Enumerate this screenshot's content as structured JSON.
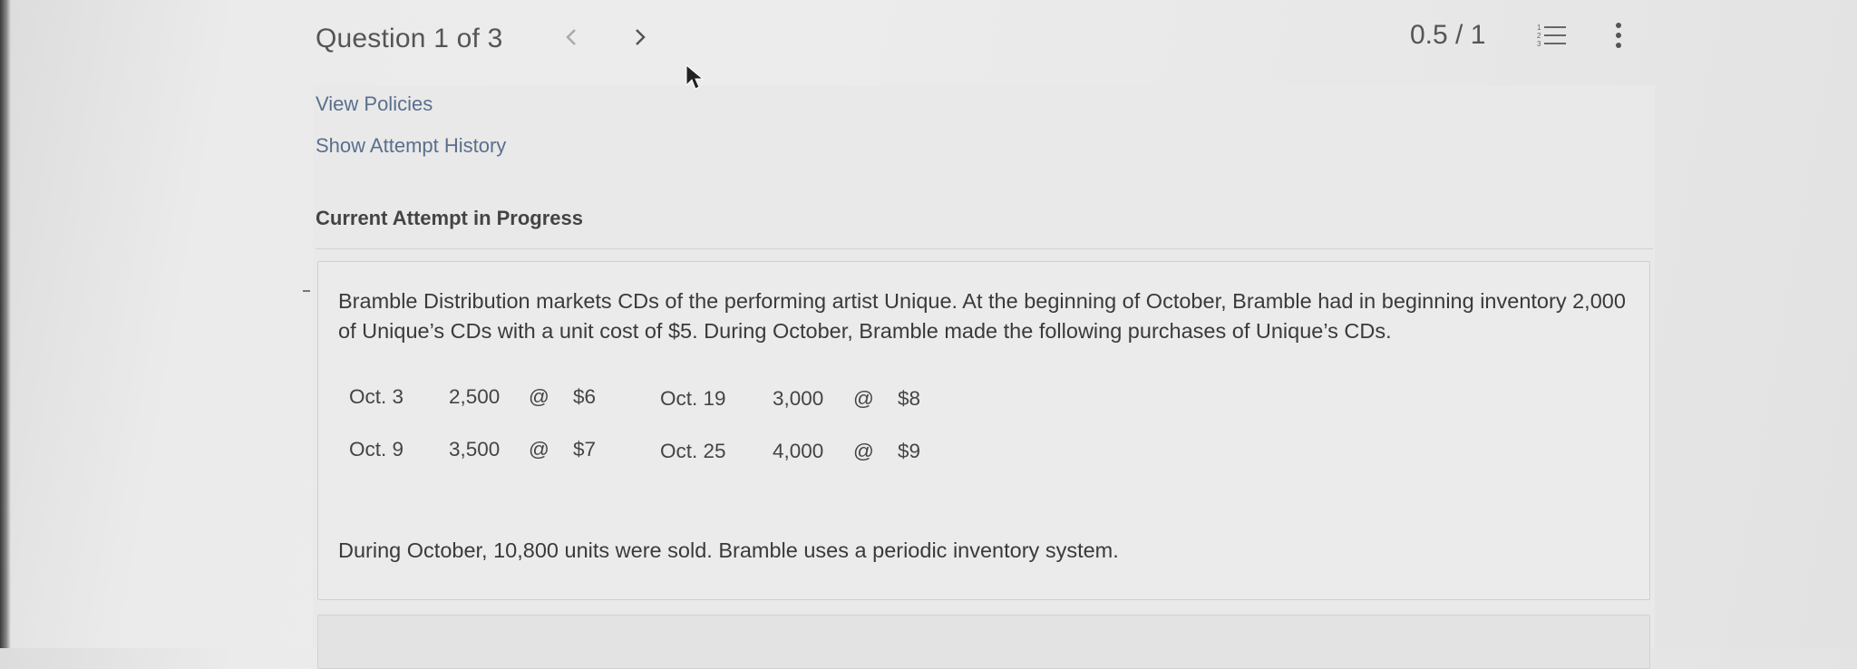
{
  "header": {
    "question_label": "Question 1 of 3",
    "prev_icon": "chevron-left-icon",
    "next_icon": "chevron-right-icon",
    "score": "0.5 / 1",
    "list_icon": "numbered-list-icon",
    "more_icon": "more-vertical-icon"
  },
  "links": {
    "view_policies": "View Policies",
    "show_attempt_history": "Show Attempt History"
  },
  "attempt": {
    "heading": "Current Attempt in Progress"
  },
  "question": {
    "intro": "Bramble Distribution markets CDs of the performing artist Unique. At the beginning of October, Bramble had in beginning inventory 2,000 of Unique’s CDs with a unit cost of $5. During October, Bramble made the following purchases of Unique’s CDs.",
    "purchases": [
      {
        "date": "Oct. 3",
        "units": "2,500",
        "at": "@",
        "cost": "$6"
      },
      {
        "date": "Oct. 9",
        "units": "3,500",
        "at": "@",
        "cost": "$7"
      },
      {
        "date": "Oct. 19",
        "units": "3,000",
        "at": "@",
        "cost": "$8"
      },
      {
        "date": "Oct. 25",
        "units": "4,000",
        "at": "@",
        "cost": "$9"
      }
    ],
    "sold_text": "During October, 10,800 units were sold. Bramble uses a periodic inventory system."
  },
  "colors": {
    "link": "#5a6f8e",
    "text": "#3a3a3a",
    "background": "#e9e9e9"
  }
}
